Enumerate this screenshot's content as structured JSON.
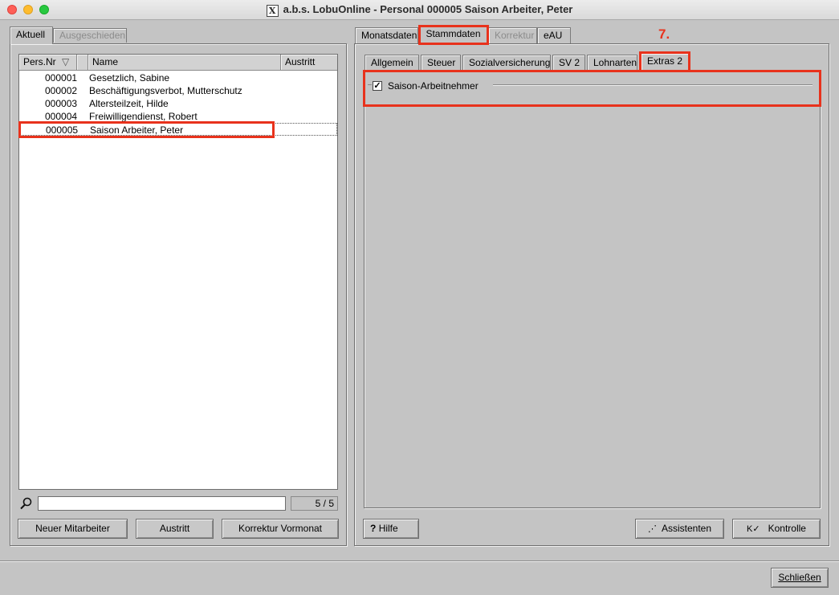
{
  "window": {
    "title": "a.b.s. LobuOnline - Personal 000005 Saison Arbeiter, Peter",
    "app_icon": "X"
  },
  "left": {
    "tabs": [
      {
        "label": "Aktuell",
        "active": true
      },
      {
        "label": "Ausgeschieden",
        "active": false
      }
    ],
    "columns": [
      "Pers.Nr",
      "Name",
      "Austritt"
    ],
    "sort_icon": "▽",
    "rows": [
      {
        "nr": "000001",
        "name": "Gesetzlich, Sabine"
      },
      {
        "nr": "000002",
        "name": "Beschäftigungsverbot, Mutterschutz"
      },
      {
        "nr": "000003",
        "name": "Altersteilzeit, Hilde"
      },
      {
        "nr": "000004",
        "name": "Freiwilligendienst, Robert"
      },
      {
        "nr": "000005",
        "name": "Saison Arbeiter, Peter"
      }
    ],
    "count": "5 / 5",
    "buttons": {
      "new": "Neuer Mitarbeiter",
      "exit": "Austritt",
      "correction": "Korrektur Vormonat"
    }
  },
  "right": {
    "main_tabs": [
      {
        "label": "Monatsdaten"
      },
      {
        "label": "Stammdaten",
        "active": true
      },
      {
        "label": "Korrektur",
        "disabled": true
      },
      {
        "label": "eAU"
      }
    ],
    "step_label": "7.",
    "sub_tabs": [
      {
        "label": "Allgemein"
      },
      {
        "label": "Steuer"
      },
      {
        "label": "Sozialversicherung"
      },
      {
        "label": "SV 2"
      },
      {
        "label": "Lohnarten"
      },
      {
        "label": "Extras 2",
        "active": true
      }
    ],
    "checkbox": {
      "label": "Saison-Arbeitnehmer",
      "checked": true,
      "mark": "✓"
    },
    "buttons": {
      "help_icon": "?",
      "help": "Hilfe",
      "assistant_icon": "⋰",
      "assistant": "Assistenten",
      "control_icon": "K✓",
      "control": "Kontrolle"
    }
  },
  "footer": {
    "close": "Schließen"
  },
  "colors": {
    "highlight": "#e8321c",
    "background": "#c4c4c4"
  }
}
